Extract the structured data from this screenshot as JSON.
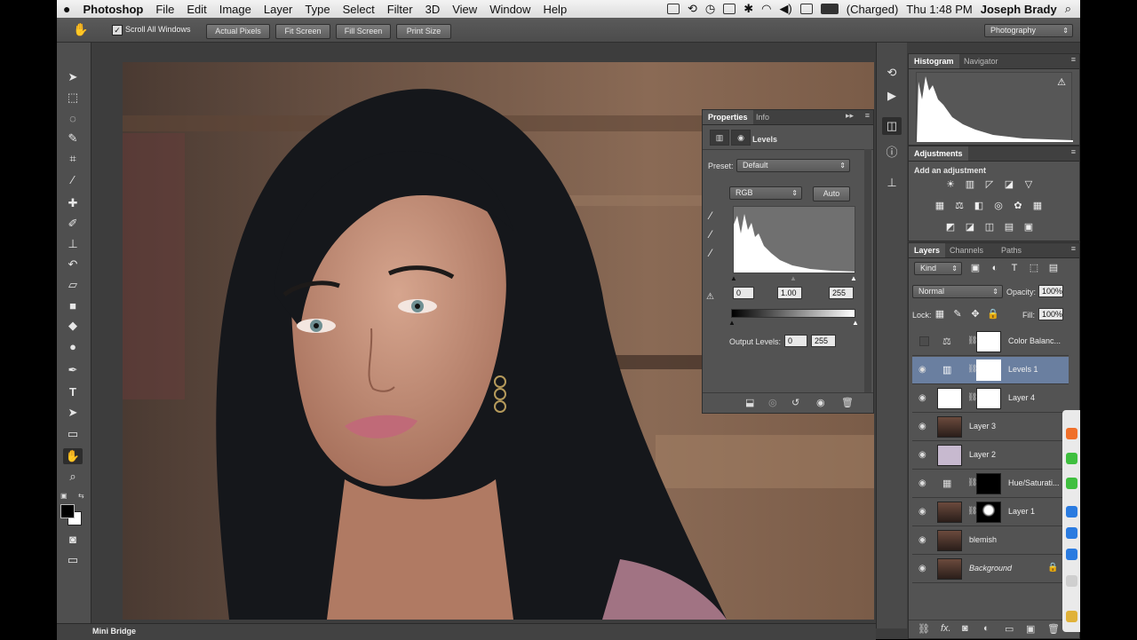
{
  "menubar": {
    "apple": "",
    "app_name": "Photoshop",
    "menus": [
      "File",
      "Edit",
      "Image",
      "Layer",
      "Type",
      "Select",
      "Filter",
      "3D",
      "View",
      "Window",
      "Help"
    ],
    "battery": "(Charged)",
    "clock": "Thu 1:48 PM",
    "user": "Joseph Brady"
  },
  "optionsbar": {
    "scroll_all": "Scroll All Windows",
    "buttons": [
      "Actual Pixels",
      "Fit Screen",
      "Fill Screen",
      "Print Size"
    ],
    "workspace": "Photography"
  },
  "properties": {
    "tabs": [
      "Properties",
      "Info"
    ],
    "title": "Levels",
    "preset_label": "Preset:",
    "preset_value": "Default",
    "channel": "RGB",
    "auto": "Auto",
    "input_black": "0",
    "input_gamma": "1.00",
    "input_white": "255",
    "output_label": "Output Levels:",
    "output_black": "0",
    "output_white": "255"
  },
  "histogram": {
    "tabs": [
      "Histogram",
      "Navigator"
    ],
    "warning": "⚠"
  },
  "adjustments": {
    "title": "Adjustments",
    "subtitle": "Add an adjustment"
  },
  "layers": {
    "tabs": [
      "Layers",
      "Channels",
      "Paths"
    ],
    "kind": "Kind",
    "blend": "Normal",
    "opacity_label": "Opacity:",
    "opacity": "100%",
    "lock_label": "Lock:",
    "fill_label": "Fill:",
    "fill": "100%",
    "items": [
      {
        "name": "Color Balanc..."
      },
      {
        "name": "Levels 1"
      },
      {
        "name": "Layer 4"
      },
      {
        "name": "Layer 3"
      },
      {
        "name": "Layer 2"
      },
      {
        "name": "Hue/Saturati..."
      },
      {
        "name": "Layer 1"
      },
      {
        "name": "blemish"
      },
      {
        "name": "Background"
      }
    ]
  },
  "minibridge": {
    "label": "Mini Bridge"
  },
  "colors": {
    "panel": "#535353",
    "selection": "#6a7fa0"
  }
}
